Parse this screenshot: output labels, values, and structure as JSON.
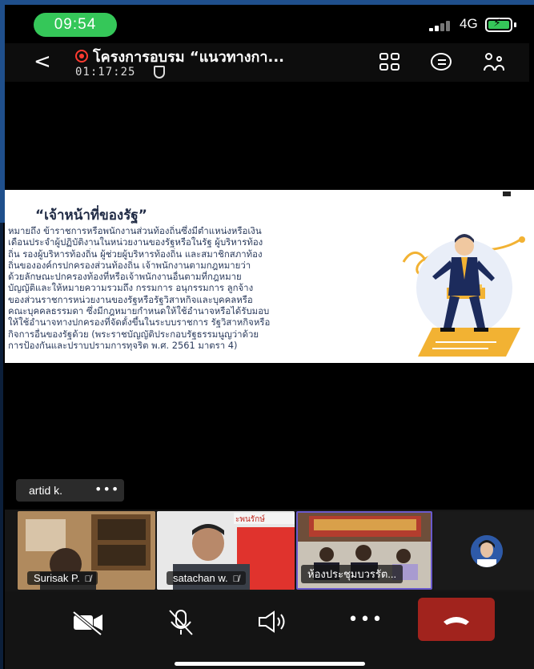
{
  "status_bar": {
    "time": "09:54",
    "network": "4G",
    "battery_color": "#35c759"
  },
  "header": {
    "back_icon": "chevron-left-icon",
    "recording_icon": "record-icon",
    "title": "โครงการอบรม “แนวทางกา...",
    "elapsed": "01:17:25",
    "icons": [
      "grid-view-icon",
      "chat-icon",
      "participants-icon"
    ]
  },
  "slide": {
    "heading": "“เจ้าหน้าที่ของรัฐ”",
    "lines": [
      "หมายถึง ข้าราชการหรือพนักงานส่วนท้องถิ่นซึ่งมีตำแหน่งหรือเงิน",
      "เดือนประจำผู้ปฏิบัติงานในหน่วยงานของรัฐหรือในรัฐ ผู้บริหารท้อง",
      "ถิ่น รองผู้บริหารท้องถิ่น ผู้ช่วยผู้บริหารท้องถิ่น และสมาชิกสภาท้อง",
      "ถิ่นขององค์กรปกครองส่วนท้องถิ่น เจ้าพนักงานตามกฎหมายว่า",
      "ด้วยลักษณะปกครองท้องที่หรือเจ้าพนักงานอื่นตามที่กฎหมาย",
      "บัญญัติและให้หมายความรวมถึง กรรมการ อนุกรรมการ ลูกจ้าง",
      "ของส่วนราชการหน่วยงานของรัฐหรือรัฐวิสาหกิจและบุคคลหรือ",
      "คณะบุคคลธรรมดา ซึ่งมีกฎหมายกำหนดให้ใช้อำนาจหรือได้รับมอบ",
      "ให้ใช้อำนาจทางปกครองที่จัดตั้งขึ้นในระบบราชการ รัฐวิสาหกิจหรือ",
      "กิจการอื่นของรัฐด้วย (พระราชบัญญัติประกอบรัฐธรรมนูญว่าด้วย",
      "การป้องกันและปราบปรามการทุจริต พ.ศ. 2561 มาตรา 4)"
    ]
  },
  "presenter": {
    "name": "artid k.",
    "more": "•••"
  },
  "participants": [
    {
      "name": "Surisak P."
    },
    {
      "name": "satachan w."
    },
    {
      "name": "ห้องประชุมบวรรัต..."
    }
  ],
  "controls": {
    "icons": [
      "video-off-icon",
      "mic-off-icon",
      "speaker-icon",
      "more-icon",
      "end-call-icon"
    ],
    "more": "•••",
    "end_call_color": "#a1231d"
  }
}
